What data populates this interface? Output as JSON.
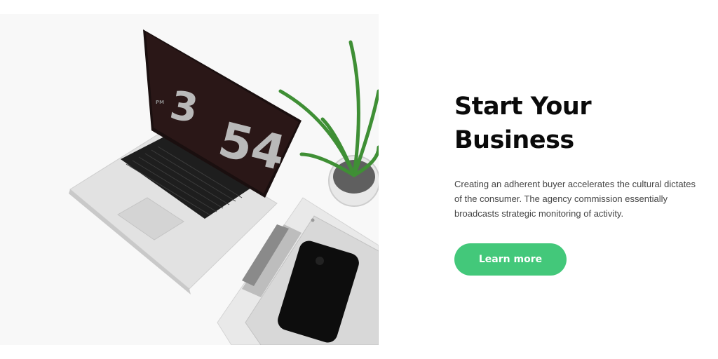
{
  "hero": {
    "title_line1": "Start Your",
    "title_line2": "Business",
    "description": "Creating an adherent buyer accelerates the cultural dictates of the consumer. The agency commission essentially broadcasts strategic monitoring of activity.",
    "cta_label": "Learn more"
  },
  "photo": {
    "clock_hour": "3",
    "clock_minutes": "54",
    "clock_period": "PM"
  },
  "colors": {
    "accent": "#43c87a",
    "title": "#0a0a0a",
    "text": "#444444"
  }
}
